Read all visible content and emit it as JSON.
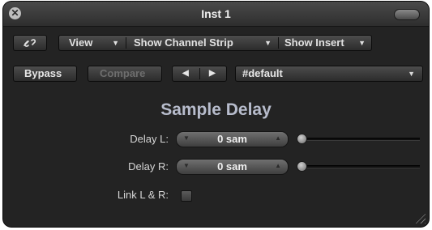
{
  "window": {
    "title": "Inst 1"
  },
  "toolbar": {
    "link_icon": "chain-link-icon",
    "view_label": "View",
    "show_channel_strip_label": "Show Channel Strip",
    "show_insert_label": "Show Insert",
    "bypass_label": "Bypass",
    "compare_label": "Compare",
    "prev_icon": "arrow-left-icon",
    "next_icon": "arrow-right-icon",
    "preset_label": "#default"
  },
  "plugin": {
    "title": "Sample Delay",
    "delay_l_label": "Delay L:",
    "delay_l_value": "0 sam",
    "delay_r_label": "Delay R:",
    "delay_r_value": "0 sam",
    "link_label": "Link L & R:",
    "link_checked": false
  }
}
